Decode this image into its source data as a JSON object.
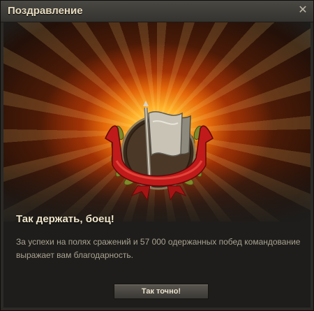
{
  "dialog": {
    "title": "Поздравление",
    "close_glyph": "✕",
    "heading": "Так держать, боец!",
    "message": "За успехи на полях сражений и 57 000 одержанных побед командование выражает вам благодарность.",
    "confirm_label": "Так точно!"
  },
  "icons": {
    "emblem": "victory-flags-laurel-icon",
    "close": "close-icon"
  },
  "colors": {
    "burst_core": "#ffdf7a",
    "burst_mid": "#f06e0a",
    "ribbon": "#c11a1a",
    "laurel": "#8a8a2a",
    "flag": "#b9b4a6"
  }
}
